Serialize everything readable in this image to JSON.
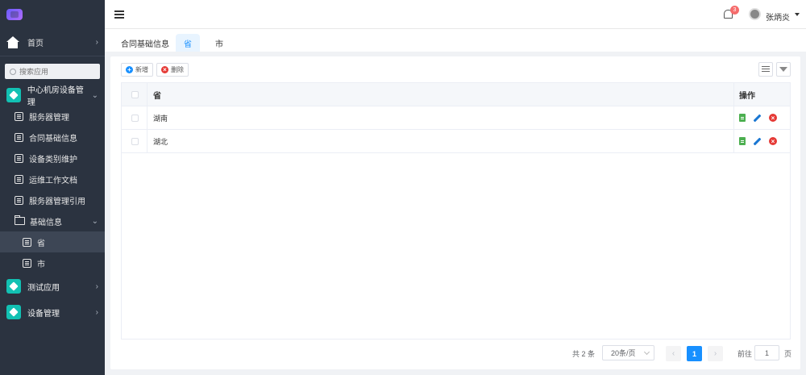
{
  "sidebar": {
    "home": "首页",
    "search_placeholder": "搜索应用",
    "groups": [
      {
        "label": "中心机房设备管理"
      },
      {
        "label": "测试应用"
      },
      {
        "label": "设备管理"
      }
    ],
    "items": [
      {
        "label": "服务器管理"
      },
      {
        "label": "合同基础信息"
      },
      {
        "label": "设备类别维护"
      },
      {
        "label": "运维工作文档"
      },
      {
        "label": "服务器管理引用"
      }
    ],
    "folder": "基础信息",
    "folder_items": [
      {
        "label": "省"
      },
      {
        "label": "市"
      }
    ]
  },
  "topbar": {
    "notification_count": "3",
    "username": "张炳炎"
  },
  "tabs": [
    {
      "label": "合同基础信息"
    },
    {
      "label": "省"
    },
    {
      "label": "市"
    }
  ],
  "toolbar": {
    "add_label": "新增",
    "delete_label": "删除"
  },
  "table": {
    "columns": [
      "省",
      "操作"
    ],
    "rows": [
      {
        "province": "湖南"
      },
      {
        "province": "湖北"
      }
    ]
  },
  "pagination": {
    "total": "共 2 条",
    "page_size": "20条/页",
    "current_page": "1",
    "goto_label": "前往",
    "goto_value": "1",
    "page_suffix": "页"
  },
  "colors": {
    "sidebar_bg": "#2b3340",
    "accent": "#1890ff",
    "cube": "#12c1b3",
    "danger": "#e53935",
    "success": "#4caf50"
  }
}
